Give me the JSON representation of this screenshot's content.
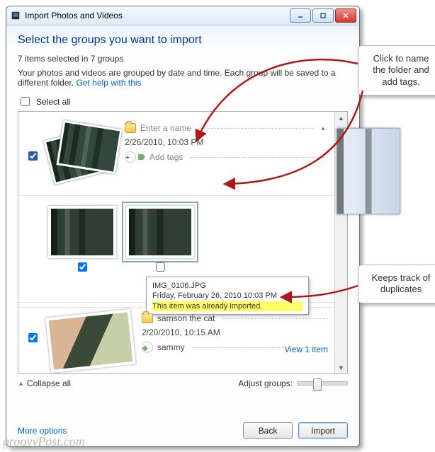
{
  "window": {
    "title": "Import Photos and Videos"
  },
  "heading": "Select the groups you want to import",
  "selection_summary": "7 items selected in 7 groups",
  "help_text": "Your photos and videos are grouped by date and time. Each group will be saved to a different folder. ",
  "help_link": "Get help with this",
  "select_all_label": "Select all",
  "groups": [
    {
      "name_placeholder": "Enter a name",
      "timestamp": "2/26/2010, 10:03 PM",
      "add_tags": "Add tags",
      "checked": true
    },
    {
      "thumbs": [
        {
          "checked": true,
          "selected": false
        },
        {
          "checked": false,
          "selected": true
        }
      ],
      "tooltip": {
        "filename": "IMG_0106.JPG",
        "date": "Friday, February 26, 2010 10:03 PM",
        "duplicate_msg": "This item was already imported."
      }
    },
    {
      "name": "samson the cat",
      "timestamp": "2/20/2010, 10:15 AM",
      "tag": "sammy",
      "view_link": "View 1 item",
      "checked": true
    }
  ],
  "collapse_all": "Collapse all",
  "adjust_groups": "Adjust groups:",
  "more_options": "More options",
  "buttons": {
    "back": "Back",
    "import": "Import"
  },
  "callouts": {
    "naming": "Click to name the folder and add tags.",
    "duplicates": "Keeps track of duplicates"
  },
  "watermark": "groovyPost.com"
}
